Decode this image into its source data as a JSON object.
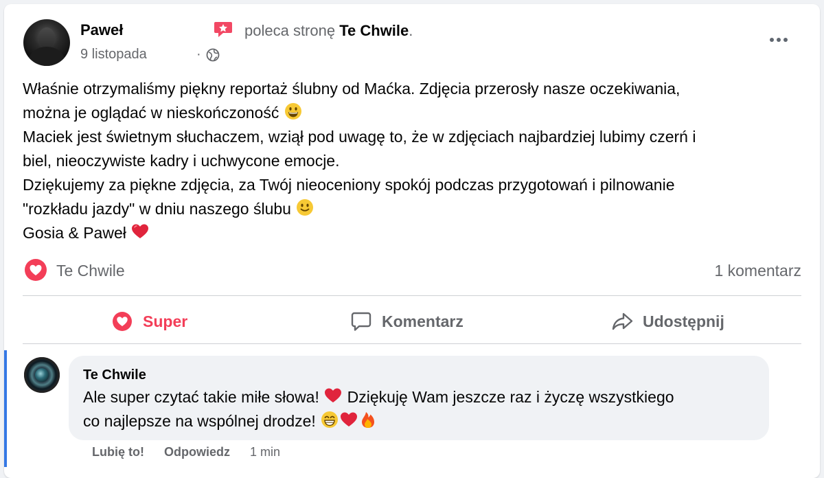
{
  "post": {
    "author": "Paweł",
    "recommendation_prefix": "poleca stronę",
    "recommended_page": "Te Chwile",
    "recommendation_suffix": ".",
    "date": "9 listopada",
    "separator": "·",
    "body": {
      "line1": "Właśnie otrzymaliśmy piękny reportaż ślubny od Maćka. Zdjęcia przerosły nasze oczekiwania,",
      "line2": "można je oglądać w nieskończoność",
      "line3": "Maciek jest świetnym słuchaczem, wziął pod uwagę to, że w zdjęciach najbardziej lubimy czerń i",
      "line4": "biel, nieoczywiste kadry i uchwycone emocje.",
      "line5": "Dziękujemy za piękne zdjęcia, za Twój nieoceniony spokój podczas przygotowań i pilnowanie",
      "line6": "\"rozkładu jazdy\" w dniu naszego ślubu",
      "line7": "Gosia & Paweł"
    },
    "reaction_name": "Te Chwile",
    "comment_count": "1 komentarz"
  },
  "actions": {
    "like_label": "Super",
    "comment_label": "Komentarz",
    "share_label": "Udostępnij"
  },
  "comment": {
    "author": "Te Chwile",
    "line1": "Ale super czytać takie miłe słowa!",
    "line1b": "Dziękuję Wam jeszcze raz i życzę wszystkiego",
    "line2": "co najlepsze na wspólnej drodze!",
    "like_label": "Lubię to!",
    "reply_label": "Odpowiedz",
    "time": "1 min"
  },
  "colors": {
    "accent_like": "#f33e58",
    "secondary_text": "#65676b",
    "bubble_bg": "#f0f2f5",
    "thread_indicator": "#3578e5"
  },
  "icons": [
    "star-badge-icon",
    "globe-icon",
    "more-icon",
    "heart-reaction-icon",
    "comment-icon",
    "share-icon",
    "grinning-emoji",
    "slightly-smiling-emoji",
    "heart-emoji",
    "beaming-emoji",
    "fire-emoji"
  ]
}
